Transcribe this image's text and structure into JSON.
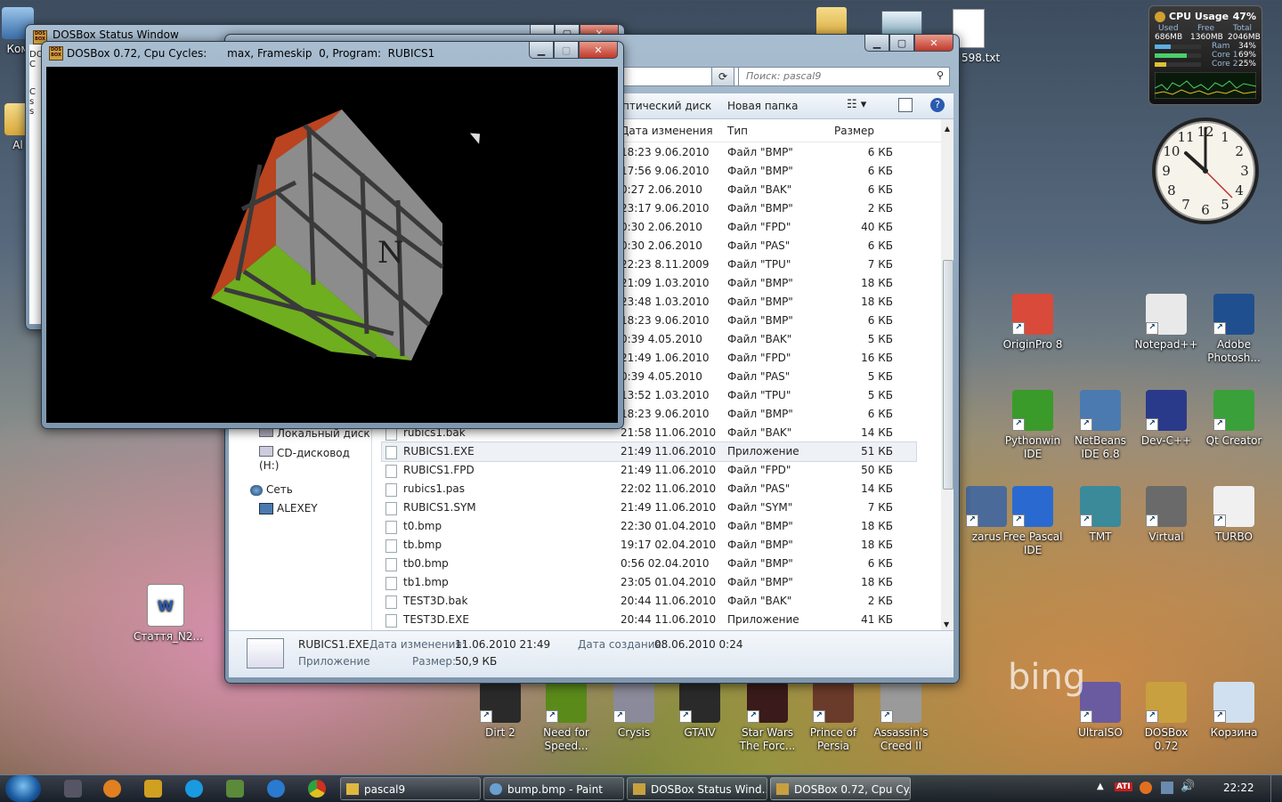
{
  "desktop": {
    "top_icons": [
      {
        "label": "Ком",
        "name": "computer-icon"
      },
      {
        "label": "Al",
        "name": "folder-icon"
      }
    ],
    "txt_label": "598.txt",
    "word_doc": "Стаття_N2...",
    "right_icons": [
      {
        "label": "OriginPro 8",
        "color": "#d94a3a"
      },
      {
        "label": "Notepad++",
        "color": "#e9e9e9"
      },
      {
        "label": "Adobe Photosh...",
        "color": "#1f4f8f"
      },
      {
        "label": "Pythonwin IDE",
        "color": "#3a9a2a"
      },
      {
        "label": "NetBeans IDE 6.8",
        "color": "#4a7ab0"
      },
      {
        "label": "Dev-C++",
        "color": "#2a3a8a"
      },
      {
        "label": "Qt Creator",
        "color": "#3aa03a"
      },
      {
        "label": "zarus",
        "color": "#4a6a9a"
      },
      {
        "label": "Free Pascal IDE",
        "color": "#2a6ad0"
      },
      {
        "label": "TMT",
        "color": "#3a8a9a"
      },
      {
        "label": "Virtual",
        "color": "#6a6a6a"
      },
      {
        "label": "TURBO",
        "color": "#f0f0f0"
      }
    ],
    "bottom_icons": [
      {
        "label": "Dirt 2",
        "color": "#2a2a2a"
      },
      {
        "label": "Need for Speed...",
        "color": "#5a8a1a"
      },
      {
        "label": "Crysis",
        "color": "#8a8a9a"
      },
      {
        "label": "GTAIV",
        "color": "#2a2a2a"
      },
      {
        "label": "Star Wars The Forc...",
        "color": "#3a1a1a"
      },
      {
        "label": "Prince of Persia",
        "color": "#6a3a2a"
      },
      {
        "label": "Assassin's Creed II",
        "color": "#9a9a9a"
      },
      {
        "label": "UltraISO",
        "color": "#6a5aa0"
      },
      {
        "label": "DOSBox 0.72",
        "color": "#c8a040"
      },
      {
        "label": "Корзина",
        "color": "#d0e0f0"
      }
    ],
    "bing_text": "bing"
  },
  "gadget": {
    "title": "CPU Usage",
    "percent": "47%",
    "used_label": "Used",
    "free_label": "Free",
    "total_label": "Total",
    "used": "686MB",
    "free": "1360MB",
    "total": "2046MB",
    "ram_label": "Ram",
    "ram_value": "34%",
    "core1_label": "Core 1",
    "core1_value": "69%",
    "core2_label": "Core 2",
    "core2_value": "25%",
    "ram_fill": 0.34,
    "core1_fill": 0.69,
    "core2_fill": 0.25
  },
  "clock": {
    "numbers": [
      "12",
      "1",
      "2",
      "3",
      "4",
      "5",
      "6",
      "7",
      "8",
      "9",
      "10",
      "11"
    ]
  },
  "dosbox_status": {
    "title": "DOSBox Status Window",
    "side_text": [
      "DO",
      "C",
      "C",
      "s",
      "s"
    ]
  },
  "dosbox_main": {
    "title": "DOSBox 0.72, Cpu Cycles:      max, Frameskip  0, Program:  RUBICS1"
  },
  "explorer": {
    "search_placeholder": "Поиск: pascal9",
    "toolbar_left": "птический диск",
    "new_folder": "Новая папка",
    "col_date": "Дата изменения",
    "col_type": "Тип",
    "col_size": "Размер",
    "nav": [
      {
        "label": "Локальный диск (E:",
        "name": "nav-local-disk-e"
      },
      {
        "label": "CD-дисковод (H:)",
        "name": "nav-cd-drive-h"
      },
      {
        "label": "Сеть",
        "name": "nav-network"
      },
      {
        "label": "ALEXEY",
        "name": "nav-alexey"
      }
    ],
    "rows": [
      {
        "name": "",
        "date": "9.06.2010 18:23",
        "type": "Файл \"BMP\"",
        "size": "6 КБ"
      },
      {
        "name": "",
        "date": "9.06.2010 17:56",
        "type": "Файл \"BMP\"",
        "size": "6 КБ"
      },
      {
        "name": "",
        "date": "2.06.2010 0:27",
        "type": "Файл \"BAK\"",
        "size": "6 КБ"
      },
      {
        "name": "",
        "date": "9.06.2010 23:17",
        "type": "Файл \"BMP\"",
        "size": "2 КБ"
      },
      {
        "name": "",
        "date": "2.06.2010 0:30",
        "type": "Файл \"FPD\"",
        "size": "40 КБ"
      },
      {
        "name": "",
        "date": "2.06.2010 0:30",
        "type": "Файл \"PAS\"",
        "size": "6 КБ"
      },
      {
        "name": "",
        "date": "8.11.2009 22:23",
        "type": "Файл \"TPU\"",
        "size": "7 КБ"
      },
      {
        "name": "",
        "date": "1.03.2010 21:09",
        "type": "Файл \"BMP\"",
        "size": "18 КБ"
      },
      {
        "name": "",
        "date": "1.03.2010 23:48",
        "type": "Файл \"BMP\"",
        "size": "18 КБ"
      },
      {
        "name": "",
        "date": "9.06.2010 18:23",
        "type": "Файл \"BMP\"",
        "size": "6 КБ"
      },
      {
        "name": "",
        "date": "4.05.2010 0:39",
        "type": "Файл \"BAK\"",
        "size": "5 КБ"
      },
      {
        "name": "",
        "date": "1.06.2010 21:49",
        "type": "Файл \"FPD\"",
        "size": "16 КБ"
      },
      {
        "name": "",
        "date": "4.05.2010 0:39",
        "type": "Файл \"PAS\"",
        "size": "5 КБ"
      },
      {
        "name": "",
        "date": "1.03.2010 13:52",
        "type": "Файл \"TPU\"",
        "size": "5 КБ"
      },
      {
        "name": "",
        "date": "9.06.2010 18:23",
        "type": "Файл \"BMP\"",
        "size": "6 КБ"
      },
      {
        "name": "rubics1.bak",
        "date": "11.06.2010 21:58",
        "type": "Файл \"BAK\"",
        "size": "14 КБ"
      },
      {
        "name": "RUBICS1.EXE",
        "date": "11.06.2010 21:49",
        "type": "Приложение",
        "size": "51 КБ"
      },
      {
        "name": "RUBICS1.FPD",
        "date": "11.06.2010 21:49",
        "type": "Файл \"FPD\"",
        "size": "50 КБ"
      },
      {
        "name": "rubics1.pas",
        "date": "11.06.2010 22:02",
        "type": "Файл \"PAS\"",
        "size": "14 КБ"
      },
      {
        "name": "RUBICS1.SYM",
        "date": "11.06.2010 21:49",
        "type": "Файл \"SYM\"",
        "size": "7 КБ"
      },
      {
        "name": "t0.bmp",
        "date": "01.04.2010 22:30",
        "type": "Файл \"BMP\"",
        "size": "18 КБ"
      },
      {
        "name": "tb.bmp",
        "date": "02.04.2010 19:17",
        "type": "Файл \"BMP\"",
        "size": "18 КБ"
      },
      {
        "name": "tb0.bmp",
        "date": "02.04.2010 0:56",
        "type": "Файл \"BMP\"",
        "size": "6 КБ"
      },
      {
        "name": "tb1.bmp",
        "date": "01.04.2010 23:05",
        "type": "Файл \"BMP\"",
        "size": "18 КБ"
      },
      {
        "name": "TEST3D.bak",
        "date": "11.06.2010 20:44",
        "type": "Файл \"BAK\"",
        "size": "2 КБ"
      },
      {
        "name": "TEST3D.EXE",
        "date": "11.06.2010 20:44",
        "type": "Приложение",
        "size": "41 КБ"
      }
    ],
    "selected_index": 16,
    "details": {
      "name": "RUBICS1.EXE",
      "modified_label": "Дата изменения:",
      "modified": "11.06.2010 21:49",
      "created_label": "Дата создания:",
      "created": "08.06.2010 0:24",
      "kind": "Приложение",
      "size_label": "Размер:",
      "size": "50,9 КБ"
    }
  },
  "taskbar": {
    "tasks": [
      {
        "label": "pascal9",
        "name": "task-pascal9"
      },
      {
        "label": "bump.bmp - Paint",
        "name": "task-paint"
      },
      {
        "label": "DOSBox Status Wind...",
        "name": "task-dosbox-status"
      },
      {
        "label": "DOSBox 0.72, Cpu Cy...",
        "name": "task-dosbox-main"
      }
    ],
    "time": "22:22",
    "tray_ati": "ATI"
  }
}
